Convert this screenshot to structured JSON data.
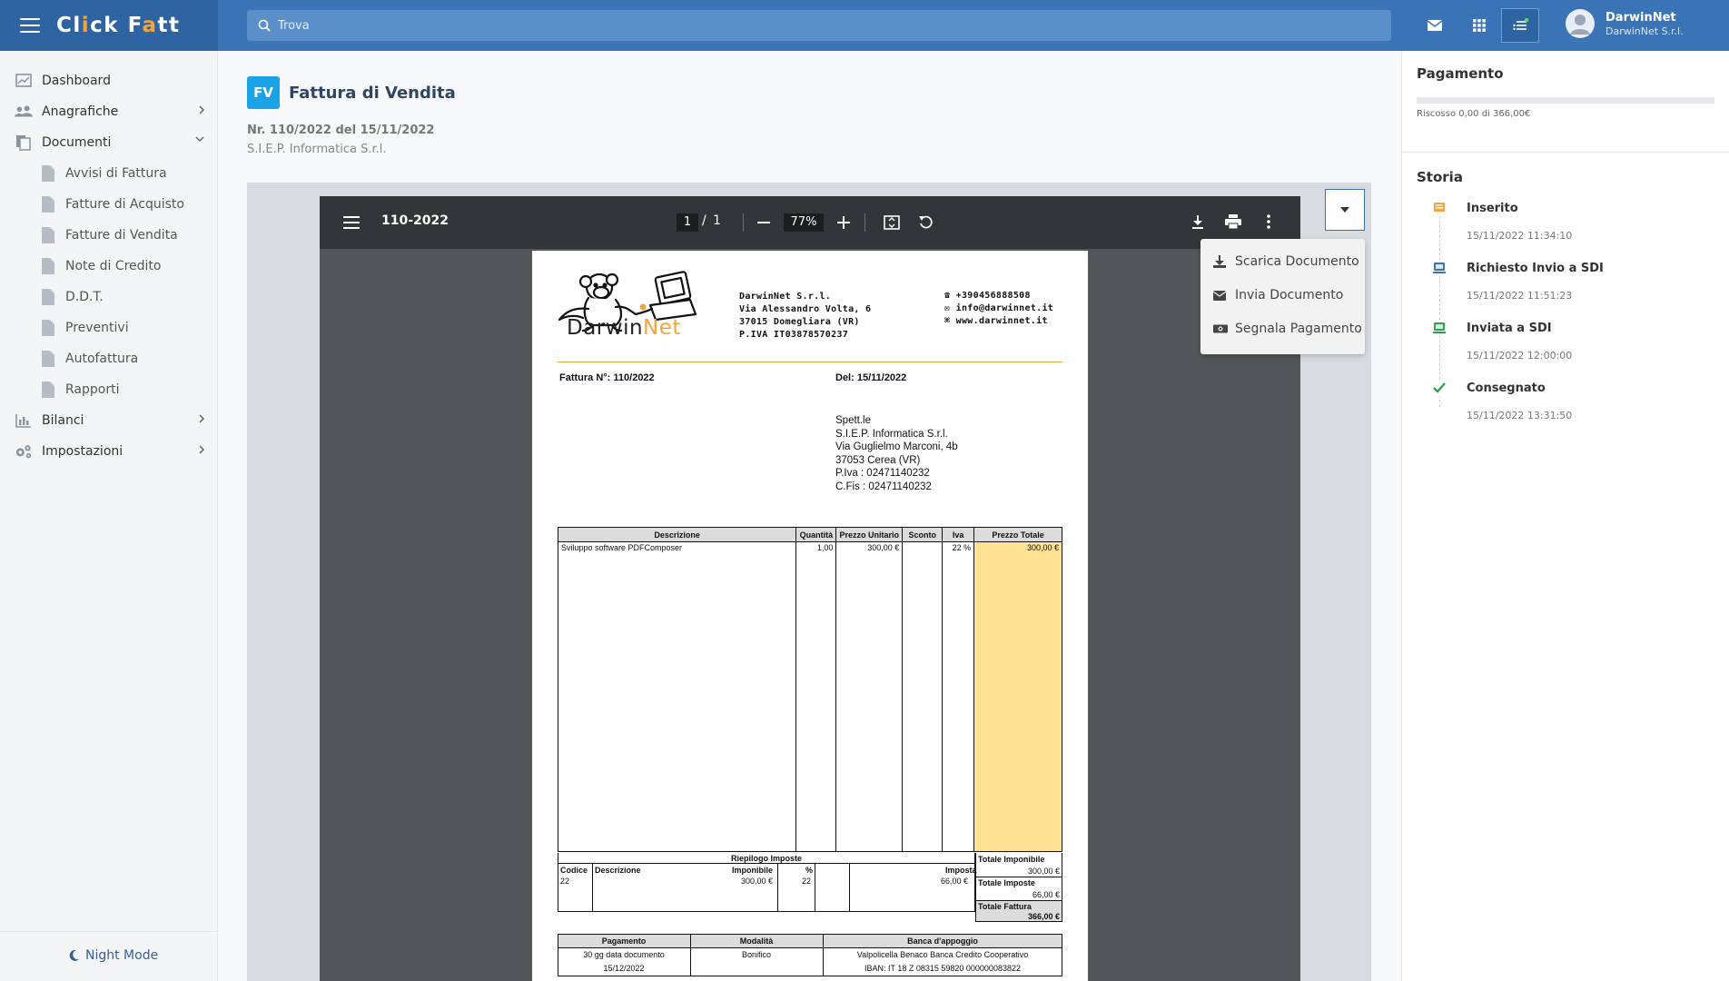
{
  "app": {
    "name_part1": "Cl",
    "name_accent": "i",
    "name_part2": "ck F",
    "name_accent2": "a",
    "name_part3": "tt"
  },
  "search": {
    "placeholder": "Trova"
  },
  "user": {
    "name": "DarwinNet",
    "company": "DarwinNet S.r.l."
  },
  "sidebar": {
    "items": [
      {
        "label": "Dashboard",
        "icon": "dashboard-icon"
      },
      {
        "label": "Anagrafiche",
        "icon": "users-icon"
      },
      {
        "label": "Documenti",
        "icon": "documents-icon"
      },
      {
        "label": "Bilanci",
        "icon": "chart-icon"
      },
      {
        "label": "Impostazioni",
        "icon": "gears-icon"
      }
    ],
    "sub_items": [
      {
        "label": "Avvisi di Fattura"
      },
      {
        "label": "Fatture di Acquisto"
      },
      {
        "label": "Fatture di Vendita"
      },
      {
        "label": "Note di Credito"
      },
      {
        "label": "D.D.T."
      },
      {
        "label": "Preventivi"
      },
      {
        "label": "Autofattura"
      },
      {
        "label": "Rapporti"
      }
    ],
    "night_mode": "Night Mode"
  },
  "document": {
    "badge": "FV",
    "title": "Fattura di Vendita",
    "number": "Nr. 110/2022 del 15/11/2022",
    "client": "S.I.E.P. Informatica S.r.l."
  },
  "pdf_viewer": {
    "file_name": "110-2022",
    "page_current": "1",
    "page_sep": "/",
    "page_total": "1",
    "zoom": "77%"
  },
  "dropdown": {
    "items": [
      {
        "label": "Scarica Documento",
        "icon": "download-icon"
      },
      {
        "label": "Invia Documento",
        "icon": "envelope-icon"
      },
      {
        "label": "Segnala Pagamento",
        "icon": "money-icon"
      }
    ]
  },
  "invoice": {
    "logo_dark": "Darwin",
    "logo_accent": "Net",
    "company_lines": [
      "DarwinNet S.r.l.",
      "Via Alessandro Volta, 6",
      "37015 Domegliara (VR)",
      "P.IVA  IT03878570237"
    ],
    "contact_phone": "+390456888508",
    "contact_email": "info@darwinnet.it",
    "contact_web": "www.darwinnet.it",
    "number_label": "Fattura N°: 110/2022",
    "date_label": "Del: 15/11/2022",
    "recipient": [
      "Spett.le",
      "S.I.E.P. Informatica S.r.l.",
      "Via Guglielmo Marconi, 4b",
      "37053 Cerea (VR)",
      "P.Iva : 02471140232",
      "C.Fis : 02471140232"
    ],
    "table_headers": [
      "Descrizione",
      "Quantità",
      "Prezzo Unitario",
      "Sconto",
      "Iva",
      "Prezzo Totale"
    ],
    "rows": [
      {
        "descrizione": "Sviluppo software PDFComposer",
        "quantita": "1,00",
        "prezzo_unitario": "300,00 €",
        "sconto": "",
        "iva": "22 %",
        "prezzo_totale": "300,00 €"
      }
    ],
    "riepilogo": {
      "title": "Riepilogo Imposte",
      "headers": [
        "Codice",
        "Descrizione",
        "Imponibile",
        "%",
        "Imposta"
      ],
      "row": {
        "codice": "22",
        "descrizione": "",
        "imponibile": "300,00 €",
        "perc": "22",
        "imposta": "66,00 €"
      }
    },
    "totals": [
      {
        "label": "Totale Imponibile",
        "value": "300,00 €"
      },
      {
        "label": "Totale Imposte",
        "value": "66,00 €"
      },
      {
        "label": "Totale Fattura",
        "value": "366,00 €"
      }
    ],
    "payment": {
      "headers": [
        "Pagamento",
        "Modalità",
        "Banca d'appoggio"
      ],
      "pagamento": [
        "30 gg data documento",
        "15/12/2022"
      ],
      "modalita": "Bonifico",
      "banca": [
        "Valpolicella Benaco Banca Credito Cooperativo",
        "IBAN: IT 18 Z 08315 59820 000000083822"
      ]
    }
  },
  "right_panel": {
    "payment_title": "Pagamento",
    "payment_status": "Riscosso 0,00 di 366,00€",
    "payment_progress": 0,
    "history_title": "Storia",
    "history": [
      {
        "label": "Inserito",
        "time": "15/11/2022 11:34:10",
        "color": "#f3a53b"
      },
      {
        "label": "Richiesto Invio a SDI",
        "time": "15/11/2022 11:51:23",
        "color": "#3a73b6"
      },
      {
        "label": "Inviata a SDI",
        "time": "15/11/2022 12:00:00",
        "color": "#2ea44f"
      },
      {
        "label": "Consegnato",
        "time": "15/11/2022 13:31:50",
        "color": "#2ea44f"
      }
    ]
  },
  "colors": {
    "primary": "#3a73b6",
    "accent": "#f3a53b",
    "badge": "#1aa3e6",
    "total_column": "#ffe293"
  }
}
